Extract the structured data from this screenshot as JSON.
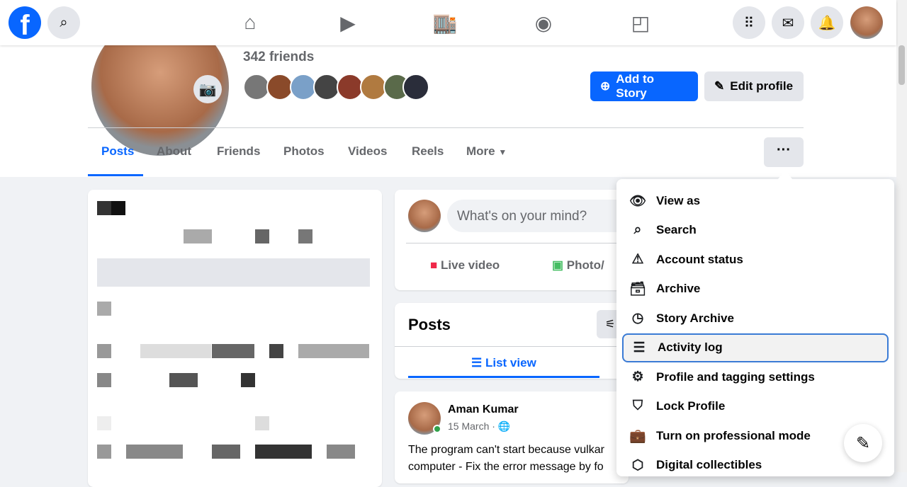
{
  "nav": {
    "logo": "f",
    "icons": [
      "search-icon",
      "home-icon",
      "video-icon",
      "marketplace-icon",
      "groups-icon",
      "gaming-icon",
      "menu-grid-icon",
      "messenger-icon",
      "notifications-icon"
    ]
  },
  "profile": {
    "friends_count": "342 friends",
    "add_story": "Add to Story",
    "edit_profile": "Edit profile"
  },
  "tabs": [
    "Posts",
    "About",
    "Friends",
    "Photos",
    "Videos",
    "Reels",
    "More"
  ],
  "more_button": "···",
  "composer": {
    "placeholder": "What's on your mind?",
    "live": "Live video",
    "photo": "Photo/"
  },
  "posts_card": {
    "title": "Posts",
    "list_view": "List view"
  },
  "post": {
    "author": "Aman Kumar",
    "date": "15 March · ",
    "text_line1": "The program can't start because vulkar",
    "text_line2": "computer - Fix the error message by fo"
  },
  "menu": {
    "items": [
      {
        "label": "View as",
        "icon": "eye-icon",
        "glyph": "👁"
      },
      {
        "label": "Search",
        "icon": "search-icon",
        "glyph": "⌕"
      },
      {
        "label": "Account status",
        "icon": "warning-icon",
        "glyph": "⚠"
      },
      {
        "label": "Archive",
        "icon": "archive-icon",
        "glyph": "🗃"
      },
      {
        "label": "Story Archive",
        "icon": "story-clock-icon",
        "glyph": "◷"
      },
      {
        "label": "Activity log",
        "icon": "list-icon",
        "glyph": "☰"
      },
      {
        "label": "Profile and tagging settings",
        "icon": "profile-settings-icon",
        "glyph": "⚙"
      },
      {
        "label": "Lock Profile",
        "icon": "shield-lock-icon",
        "glyph": "⛉"
      },
      {
        "label": "Turn on professional mode",
        "icon": "briefcase-icon",
        "glyph": "💼"
      },
      {
        "label": "Digital collectibles",
        "icon": "collectible-icon",
        "glyph": "⬡"
      }
    ],
    "selected": "Activity log"
  },
  "colors": {
    "brand": "#0866ff",
    "bg": "#f0f2f5"
  }
}
